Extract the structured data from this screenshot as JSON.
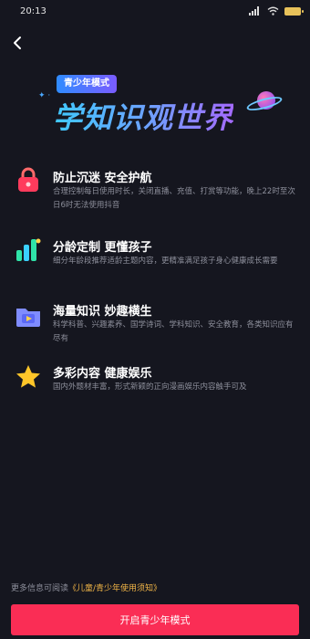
{
  "status_bar": {
    "time": "20:13",
    "battery": "100"
  },
  "nav": {
    "back_icon": "chevron-left-icon"
  },
  "hero": {
    "badge": "青少年模式",
    "title": "学知识观世界"
  },
  "features": [
    {
      "icon": "lock-icon",
      "title": "防止沉迷 安全护航",
      "desc": "合理控制每日使用时长，关闭直播、充值、打赏等功能，晚上22时至次日6时无法使用抖音"
    },
    {
      "icon": "bar-chart-icon",
      "title": "分龄定制 更懂孩子",
      "desc": "细分年龄段推荐适龄主题内容，更精准满足孩子身心健康成长需要"
    },
    {
      "icon": "folder-icon",
      "title": "海量知识 妙趣横生",
      "desc": "科学科普、兴趣素养、国学诗词、学科知识、安全教育，各类知识应有尽有"
    },
    {
      "icon": "star-icon",
      "title": "多彩内容 健康娱乐",
      "desc": "国内外题材丰富，形式新颖的正向漫画娱乐内容触手可及"
    }
  ],
  "footer": {
    "note_prefix": "更多信息可阅读",
    "link": "《儿童/青少年使用须知》"
  },
  "primary_button": "开启青少年模式"
}
